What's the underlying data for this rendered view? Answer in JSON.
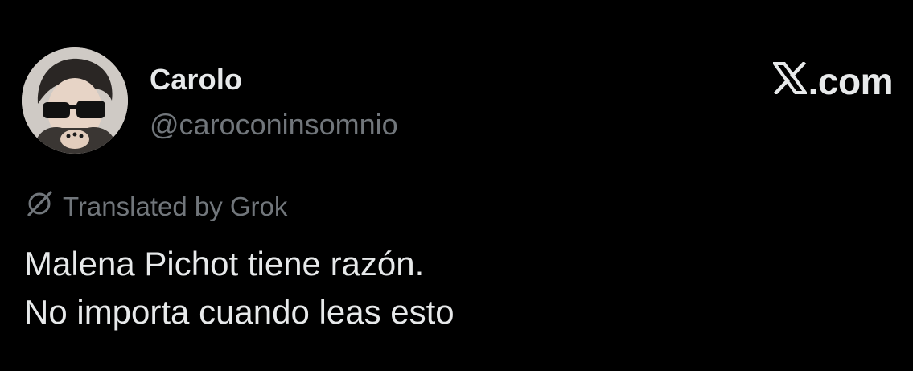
{
  "author": {
    "display_name": "Carolo",
    "handle": "@caroconinsomnio",
    "avatar_icon": "profile-photo"
  },
  "brand": {
    "site_label": ".com",
    "logo_icon": "x-logo-icon"
  },
  "translation": {
    "label": "Translated by Grok",
    "icon": "grok-icon"
  },
  "tweet": {
    "lines": [
      "Malena Pichot tiene razón.",
      "No importa cuando leas esto"
    ]
  },
  "colors": {
    "background": "#000000",
    "primary_text": "#e7e9ea",
    "secondary_text": "#71767b"
  }
}
